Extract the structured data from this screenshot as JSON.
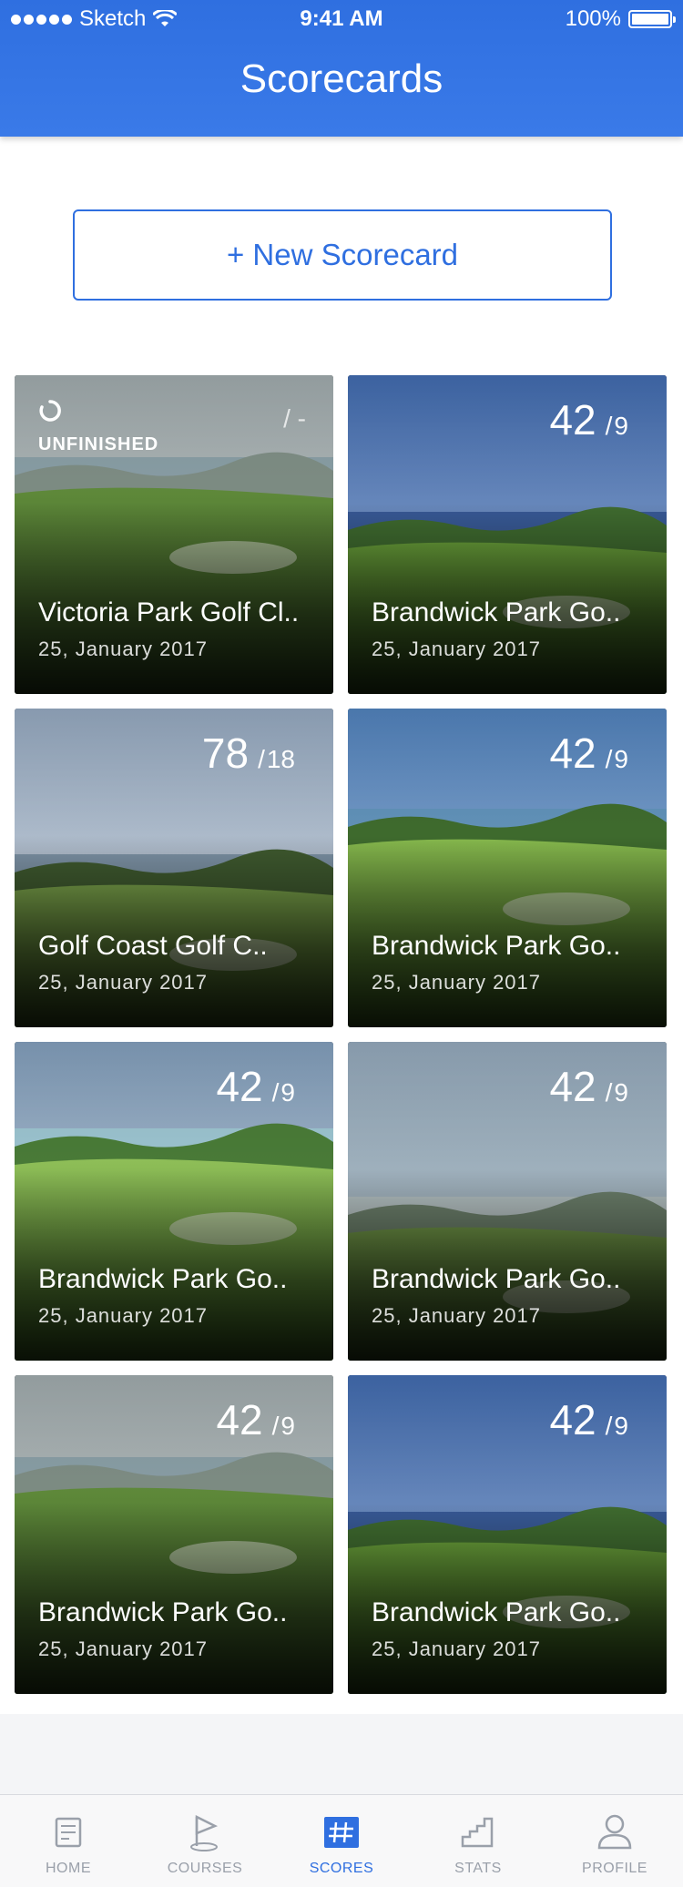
{
  "status_bar": {
    "carrier": "Sketch",
    "time": "9:41 AM",
    "battery": "100%",
    "battery_level": 1.0
  },
  "header": {
    "title": "Scorecards"
  },
  "new_scorecard_label": "+ New Scorecard",
  "cards": [
    {
      "status": "UNFINISHED",
      "score": "",
      "total": "",
      "placeholder": "/ -",
      "course": "Victoria Park Golf Cl..",
      "date": "25, January 2017",
      "scene": "coast"
    },
    {
      "status": "",
      "score": "42",
      "total": "9",
      "course": "Brandwick Park Go..",
      "date": "25, January 2017",
      "scene": "lake"
    },
    {
      "status": "",
      "score": "78",
      "total": "18",
      "course": "Golf Coast Golf C..",
      "date": "25, January 2017",
      "scene": "cloudy"
    },
    {
      "status": "",
      "score": "42",
      "total": "9",
      "course": "Brandwick Park Go..",
      "date": "25, January 2017",
      "scene": "resort"
    },
    {
      "status": "",
      "score": "42",
      "total": "9",
      "course": "Brandwick Park Go..",
      "date": "25, January 2017",
      "scene": "beach"
    },
    {
      "status": "",
      "score": "42",
      "total": "9",
      "course": "Brandwick Park Go..",
      "date": "25, January 2017",
      "scene": "misty"
    },
    {
      "status": "",
      "score": "42",
      "total": "9",
      "course": "Brandwick Park Go..",
      "date": "25, January 2017",
      "scene": "coast"
    },
    {
      "status": "",
      "score": "42",
      "total": "9",
      "course": "Brandwick Park Go..",
      "date": "25, January 2017",
      "scene": "lake"
    }
  ],
  "tabs": [
    {
      "label": "HOME",
      "icon": "home-icon",
      "active": false
    },
    {
      "label": "COURSES",
      "icon": "flag-icon",
      "active": false
    },
    {
      "label": "SCORES",
      "icon": "scores-icon",
      "active": true
    },
    {
      "label": "STATS",
      "icon": "stats-icon",
      "active": false
    },
    {
      "label": "PROFILE",
      "icon": "profile-icon",
      "active": false
    }
  ],
  "colors": {
    "brand": "#2F6FE0",
    "tab_inactive": "#9AA0AA"
  }
}
